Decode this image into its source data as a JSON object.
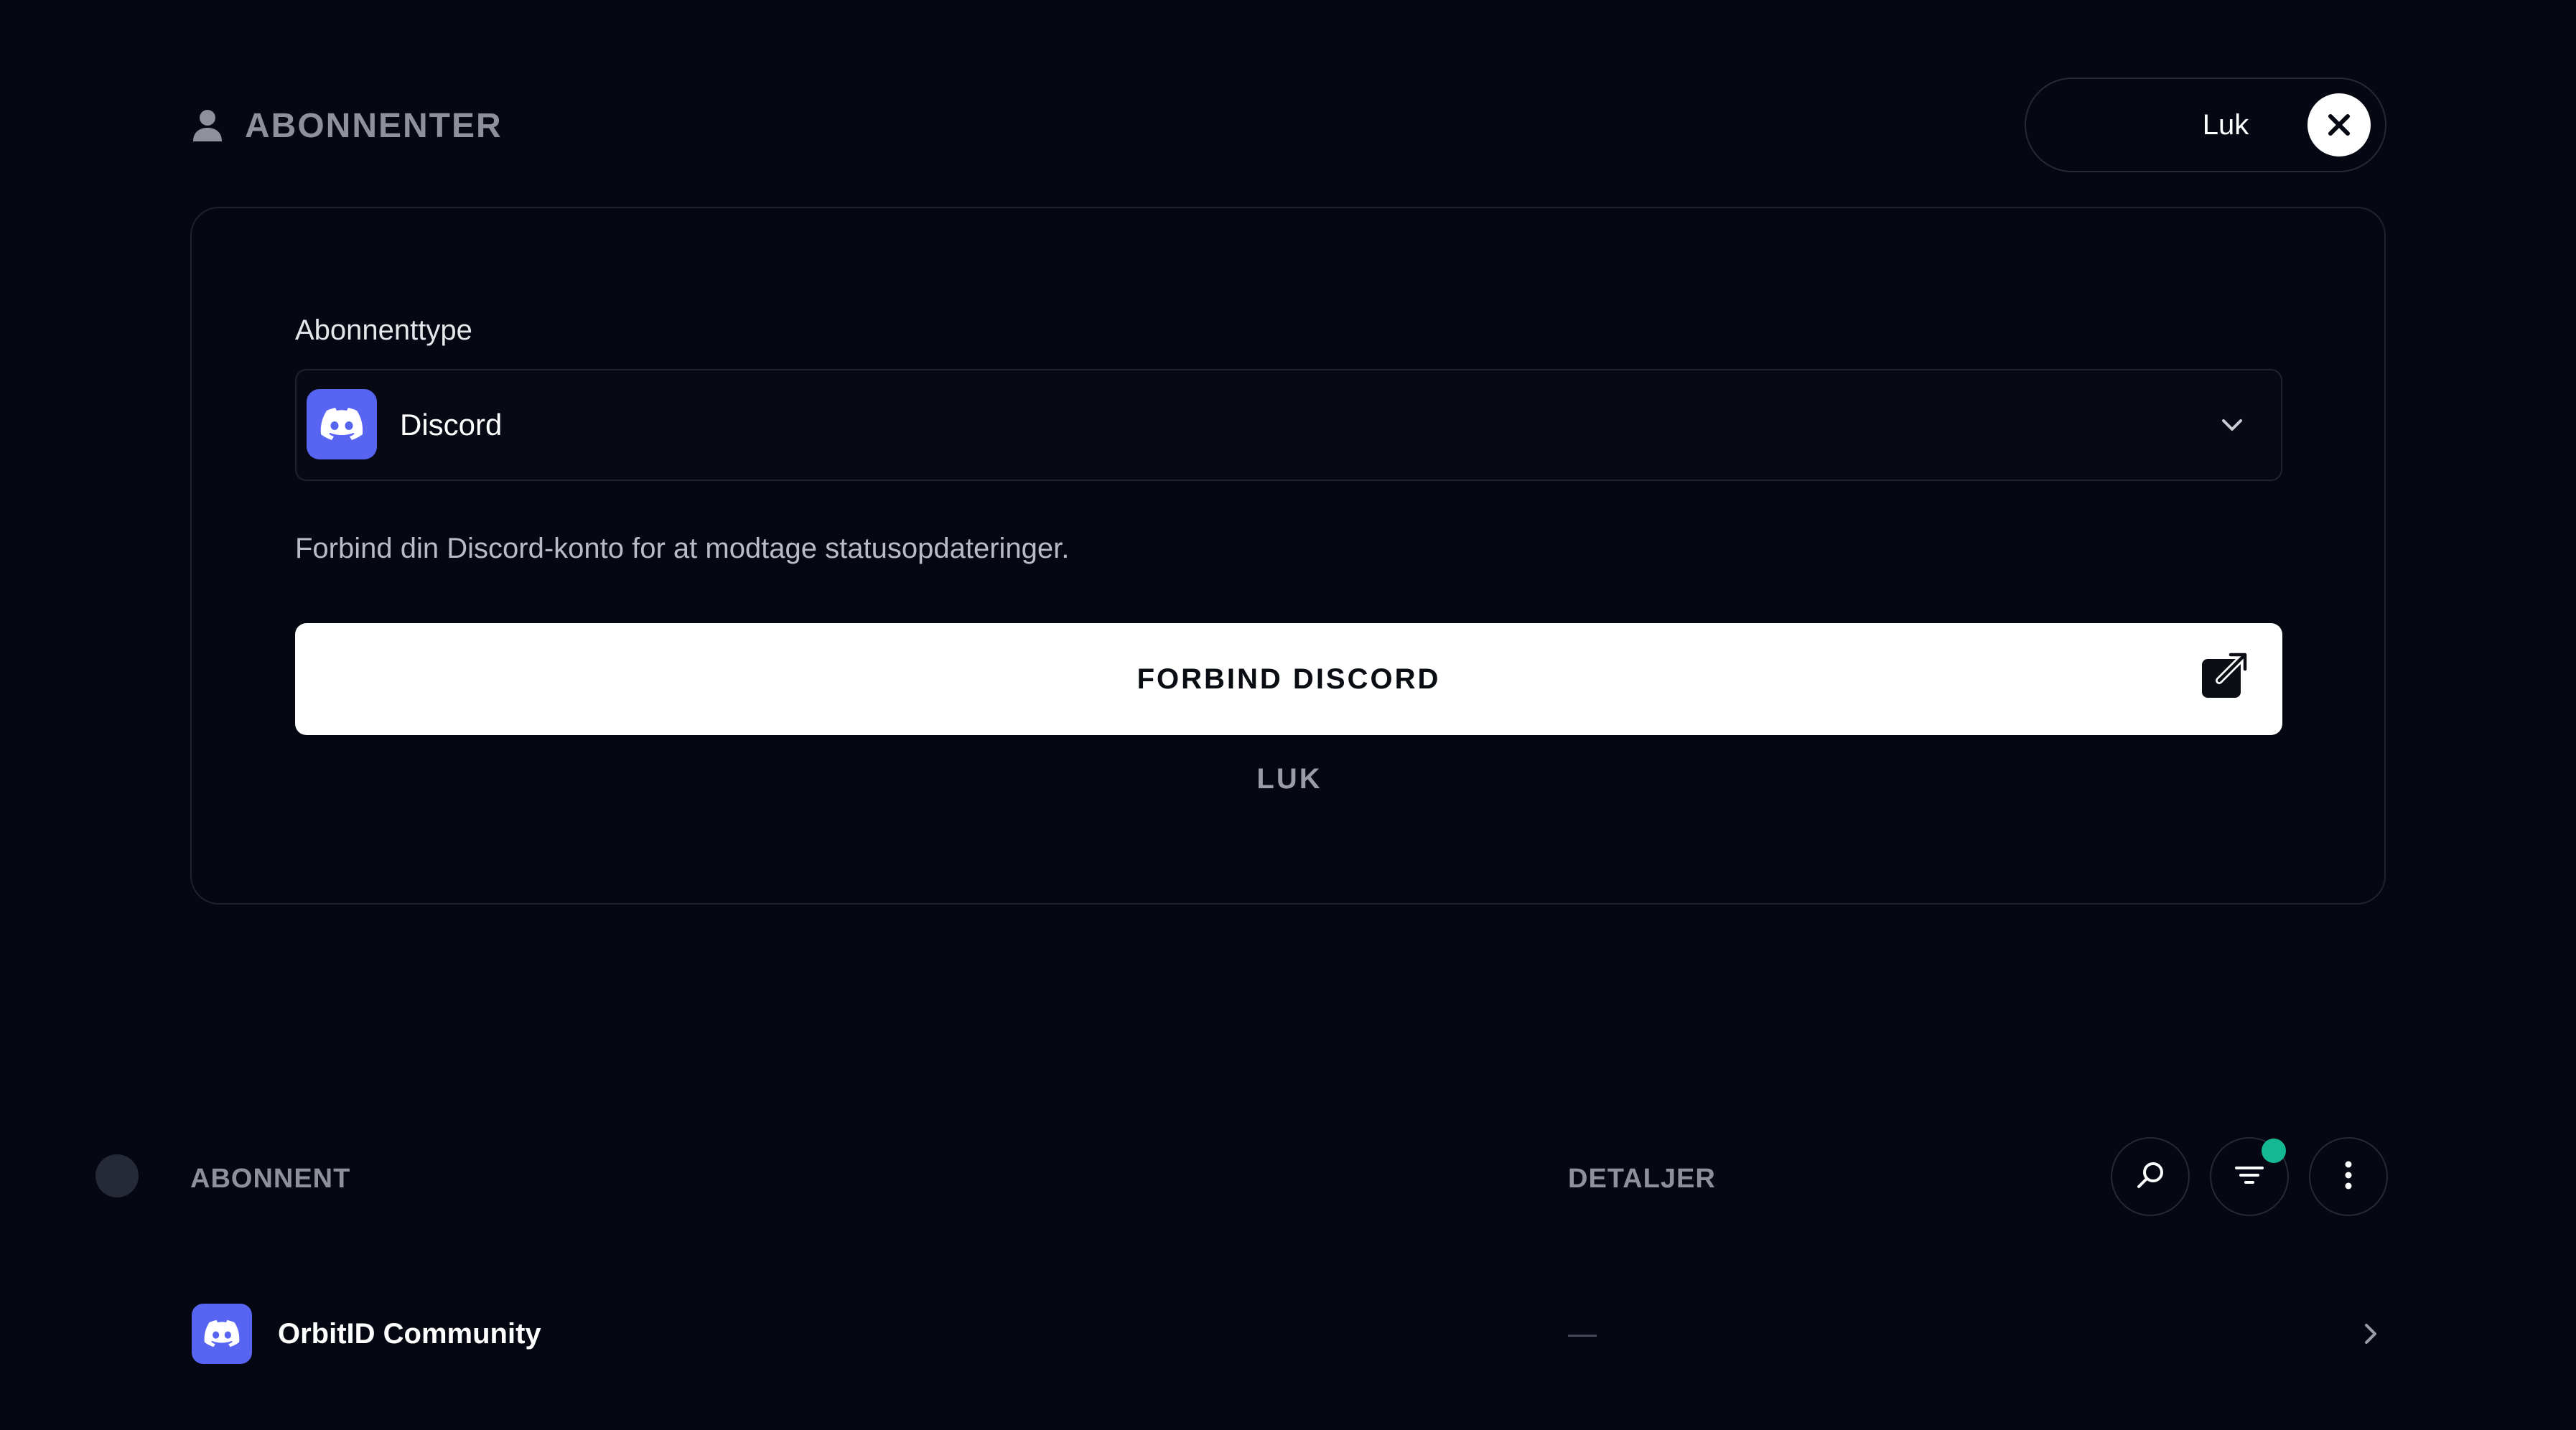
{
  "header": {
    "title": "ABONNENTER",
    "close_label": "Luk"
  },
  "form": {
    "field_label": "Abonnenttype",
    "selected_type": "Discord",
    "description": "Forbind din Discord-konto for at modtage statusopdateringer.",
    "connect_label": "FORBIND DISCORD",
    "cancel_label": "LUK"
  },
  "list": {
    "columns": {
      "subscriber": "ABONNENT",
      "details": "DETALJER"
    },
    "filter_active": true,
    "rows": [
      {
        "type_icon": "discord-icon",
        "name": "OrbitID Community",
        "details": "—"
      }
    ]
  },
  "colors": {
    "background": "#050812",
    "discord": "#5865f2",
    "filter_indicator": "#14b892",
    "muted_text": "#8e919b"
  },
  "icons": [
    "user-icon",
    "close-icon",
    "discord-icon",
    "chevron-down-icon",
    "external-link-icon",
    "search-icon",
    "filter-icon",
    "more-vertical-icon",
    "chevron-right-icon"
  ]
}
